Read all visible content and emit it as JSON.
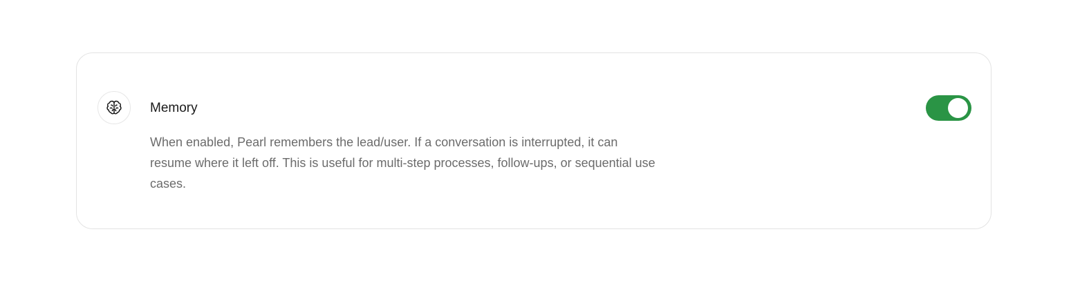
{
  "memory_setting": {
    "icon": "brain-icon",
    "title": "Memory",
    "description": "When enabled, Pearl remembers the lead/user. If a conversation is interrupted, it can resume where it left off. This is useful for multi-step processes, follow-ups, or sequential use cases.",
    "enabled": true
  },
  "colors": {
    "toggle_on": "#2a9445",
    "card_border": "#e3e3e3",
    "title_text": "#1a1a1a",
    "description_text": "#6b6b6b"
  }
}
